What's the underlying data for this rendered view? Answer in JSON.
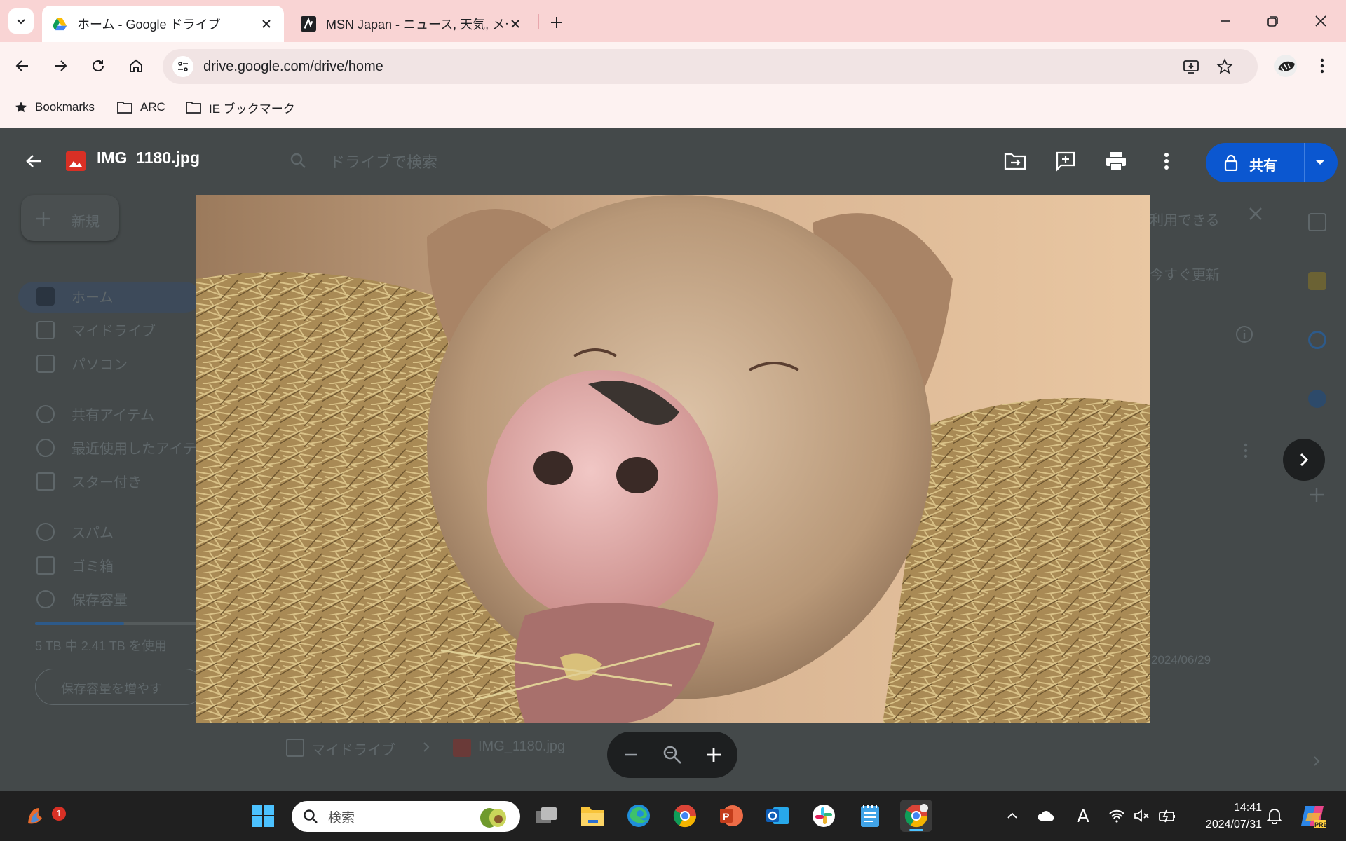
{
  "browser": {
    "tabs": [
      {
        "title": "ホーム - Google ドライブ",
        "active": true
      },
      {
        "title": "MSN Japan - ニュース, 天気, メール",
        "active": false
      }
    ],
    "url": "drive.google.com/drive/home",
    "bookmarks": [
      "Bookmarks",
      "ARC",
      "IE ブックマーク"
    ]
  },
  "drive_background": {
    "search_placeholder": "ドライブで検索",
    "new_button": "新規",
    "nav_items": [
      "ホーム",
      "マイドライブ",
      "パソコン",
      "共有アイテム",
      "最近使用したアイテム",
      "スター付き",
      "スパム",
      "ゴミ箱",
      "保存容量"
    ],
    "storage_text": "5 TB 中 2.41 TB を使用",
    "storage_button": "保存容量を増やす",
    "banner_text_1": "利用できる",
    "banner_text_2": "今すぐ更新",
    "date": "2024/06/29",
    "breadcrumb": [
      "マイドライブ",
      "IMG_1180.jpg"
    ]
  },
  "viewer": {
    "file_name": "IMG_1180.jpg",
    "share_label": "共有",
    "image_description": "pig",
    "zoom_controls": [
      "zoom-out",
      "zoom-reset",
      "zoom-in"
    ]
  },
  "taskbar": {
    "search_placeholder": "検索",
    "notification_count": "1",
    "time": "14:41",
    "date": "2024/07/31",
    "ime_label": "A"
  },
  "colors": {
    "tabbar": "#f9d4d4",
    "share_button": "#0b57d0",
    "viewer_overlay": "#44494a"
  }
}
